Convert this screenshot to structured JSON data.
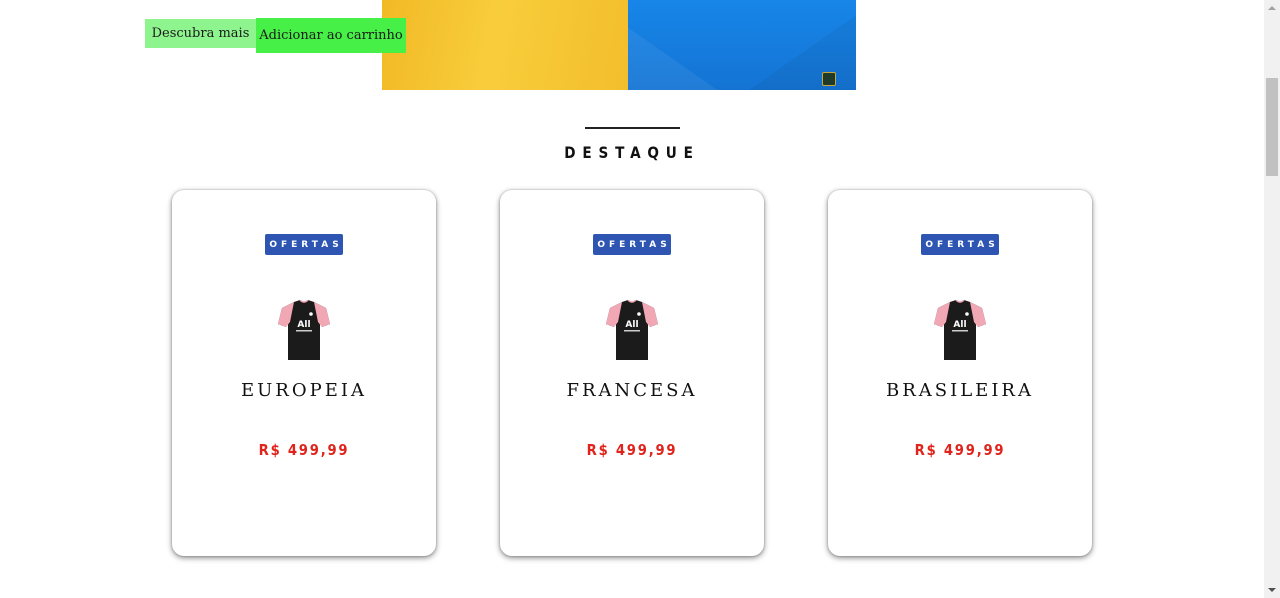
{
  "hero": {
    "colors": {
      "left": "#f5c234",
      "right": "#1a7fe0"
    }
  },
  "actions": {
    "discover_label": "Descubra mais",
    "add_to_cart_label": "Adicionar ao carrinho",
    "colors": {
      "discover": "#8ef58e",
      "add_to_cart": "#46f046"
    }
  },
  "section": {
    "title": "DESTAQUE"
  },
  "products": [
    {
      "tag": "OFERTAS",
      "name": "EUROPEIA",
      "price": "R$ 499,99",
      "icon": "jersey-icon"
    },
    {
      "tag": "OFERTAS",
      "name": "FRANCESA",
      "price": "R$ 499,99",
      "icon": "jersey-icon"
    },
    {
      "tag": "OFERTAS",
      "name": "BRASILEIRA",
      "price": "R$ 499,99",
      "icon": "jersey-icon"
    }
  ],
  "theme": {
    "tag_color": "#2f55b3",
    "price_color": "#e0241c"
  }
}
